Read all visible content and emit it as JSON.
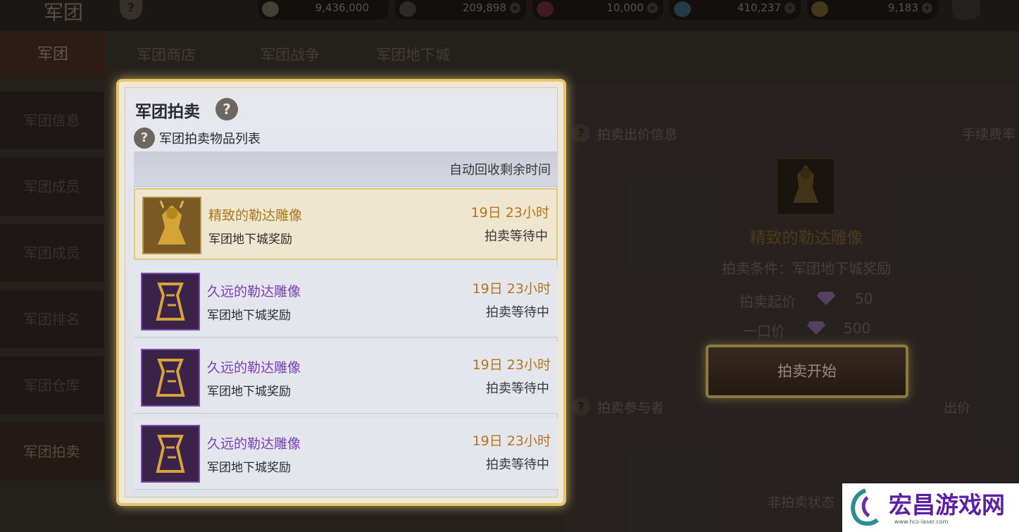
{
  "header": {
    "title": "军团",
    "help": "?",
    "resources": [
      {
        "icon": "silver-coin-icon",
        "value": "9,436,000"
      },
      {
        "icon": "shard-coin-icon",
        "value": "209,898"
      },
      {
        "icon": "red-gem-icon",
        "value": "10,000"
      },
      {
        "icon": "blue-crystal-icon",
        "value": "410,237"
      },
      {
        "icon": "gold-coin-icon",
        "value": "9,183"
      }
    ]
  },
  "tabs": [
    "军团",
    "军团商店",
    "军团战争",
    "军团地下城"
  ],
  "sidebar": [
    "军团信息",
    "军团成员",
    "军团成员",
    "军团排名",
    "军团仓库",
    "军团拍卖"
  ],
  "modal": {
    "title": "军团拍卖",
    "subtitle": "军团拍卖物品列表",
    "column_header": "自动回收剩余时间",
    "rows": [
      {
        "name": "精致的勒达雕像",
        "source": "军团地下城奖励",
        "time": "19日 23小时",
        "status": "拍卖等待中"
      },
      {
        "name": "久远的勒达雕像",
        "source": "军团地下城奖励",
        "time": "19日 23小时",
        "status": "拍卖等待中"
      },
      {
        "name": "久远的勒达雕像",
        "source": "军团地下城奖励",
        "time": "19日 23小时",
        "status": "拍卖等待中"
      },
      {
        "name": "久远的勒达雕像",
        "source": "军团地下城奖励",
        "time": "19日 23小时",
        "status": "拍卖等待中"
      }
    ]
  },
  "auction_info": {
    "header": "拍卖出价信息",
    "fee_label": "手续费率",
    "item_name": "精致的勒达雕像",
    "condition": "拍卖条件：军团地下城奖励",
    "start_label": "拍卖起价",
    "start_value": "50",
    "buyout_label": "一口价",
    "buyout_value": "500",
    "start_button": "拍卖开始",
    "participants_header": "拍卖参与者",
    "bid_label": "出价",
    "empty_state": "非拍卖状态"
  },
  "watermark": {
    "title": "宏昌游戏网",
    "url": "www.hcs-laser.com"
  }
}
